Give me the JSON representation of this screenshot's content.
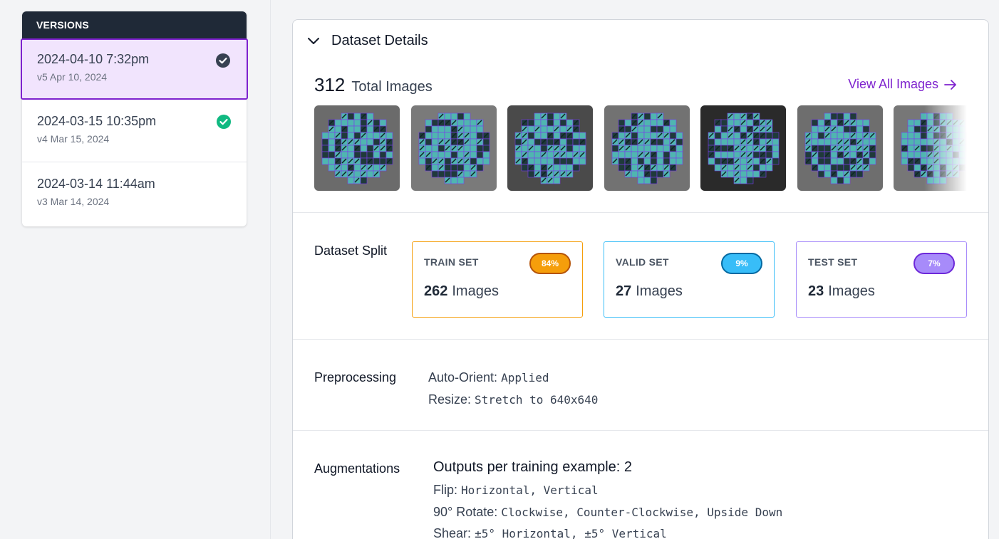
{
  "versions": {
    "header": "VERSIONS",
    "items": [
      {
        "date": "2024-04-10 7:32pm",
        "sub": "v5 Apr 10, 2024",
        "status_icon": "check-circle-dark",
        "status_color": "#374151"
      },
      {
        "date": "2024-03-15 10:35pm",
        "sub": "v4 Mar 15, 2024",
        "status_icon": "check-circle-green",
        "status_color": "#10b981"
      },
      {
        "date": "2024-03-14 11:44am",
        "sub": "v3 Mar 14, 2024"
      }
    ]
  },
  "details": {
    "title": "Dataset Details",
    "total_count": "312",
    "total_label": "Total Images",
    "view_all": "View All Images",
    "thumbnail_count": 7
  },
  "split": {
    "label": "Dataset Split",
    "sets": [
      {
        "title": "TRAIN SET",
        "percent": "84%",
        "count": "262",
        "unit": "Images",
        "color": "#f59e0b",
        "badge_border": "#b45309"
      },
      {
        "title": "VALID SET",
        "percent": "9%",
        "count": "27",
        "unit": "Images",
        "color": "#38bdf8",
        "badge_border": "#0369a1"
      },
      {
        "title": "TEST SET",
        "percent": "7%",
        "count": "23",
        "unit": "Images",
        "color": "#a78bfa",
        "badge_border": "#6d28d9"
      }
    ]
  },
  "preprocessing": {
    "label": "Preprocessing",
    "items": [
      {
        "key": "Auto-Orient:",
        "value": "Applied"
      },
      {
        "key": "Resize:",
        "value": "Stretch to 640x640"
      }
    ]
  },
  "augmentations": {
    "label": "Augmentations",
    "outputs": "Outputs per training example: 2",
    "items": [
      {
        "key": "Flip:",
        "value": "Horizontal, Vertical"
      },
      {
        "key": "90° Rotate:",
        "value": "Clockwise, Counter-Clockwise, Upside Down"
      },
      {
        "key": "Shear:",
        "value": "±5° Horizontal, ±5° Vertical"
      }
    ]
  },
  "colors": {
    "accent": "#7e22ce",
    "active_bg": "#f1e4fd",
    "header_bg": "#1f2937"
  }
}
